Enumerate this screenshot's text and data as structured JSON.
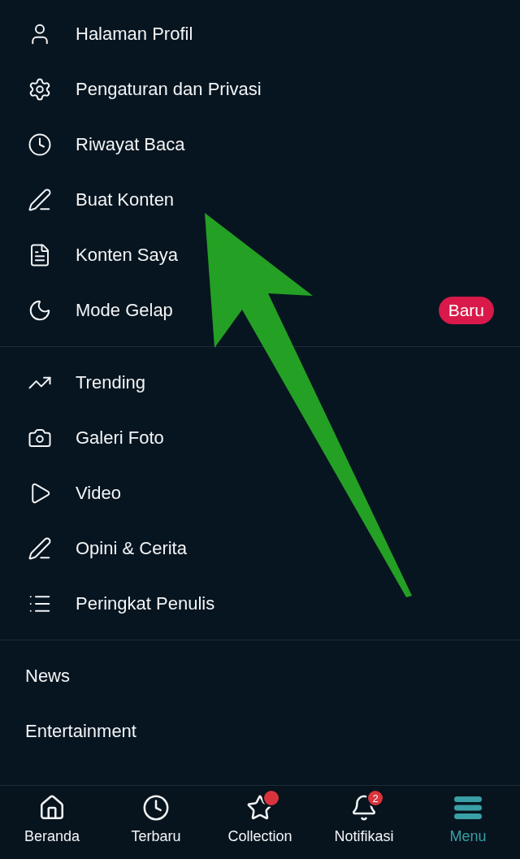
{
  "menu_sections": [
    {
      "kind": "icon_list",
      "items": [
        {
          "label": "Halaman Profil"
        },
        {
          "label": "Pengaturan dan Privasi"
        },
        {
          "label": "Riwayat Baca"
        },
        {
          "label": "Buat Konten"
        },
        {
          "label": "Konten Saya"
        },
        {
          "label": "Mode Gelap",
          "badge": "Baru"
        }
      ]
    },
    {
      "kind": "icon_list",
      "items": [
        {
          "label": "Trending"
        },
        {
          "label": "Galeri Foto"
        },
        {
          "label": "Video"
        },
        {
          "label": "Opini & Cerita"
        },
        {
          "label": "Peringkat Penulis"
        }
      ]
    },
    {
      "kind": "text_list",
      "items": [
        {
          "label": "News"
        },
        {
          "label": "Entertainment"
        }
      ]
    }
  ],
  "bottom_nav": [
    {
      "label": "Beranda",
      "selected": false,
      "dot": false
    },
    {
      "label": "Terbaru",
      "selected": false,
      "dot": false
    },
    {
      "label": "Collection",
      "selected": false,
      "dot": true
    },
    {
      "label": "Notifikasi",
      "selected": false,
      "dot": false,
      "count": "2"
    },
    {
      "label": "Menu",
      "selected": true,
      "dot": false
    }
  ]
}
